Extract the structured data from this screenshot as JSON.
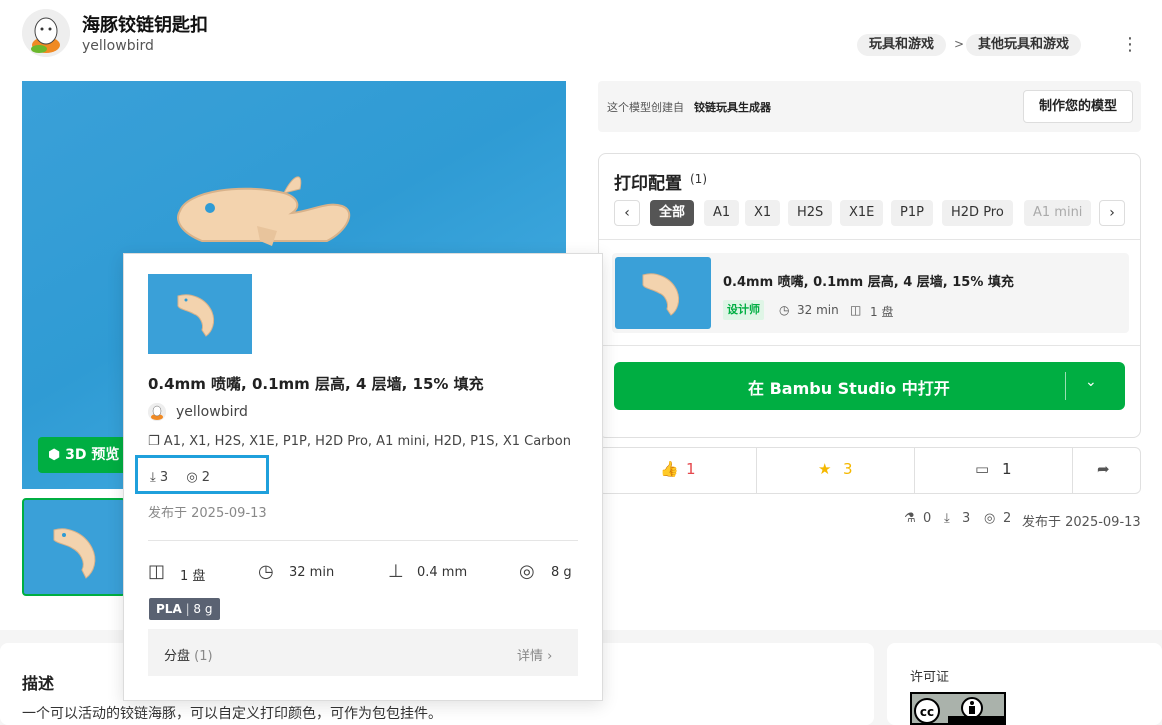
{
  "header": {
    "title": "海豚铰链钥匙扣",
    "author": "yellowbird",
    "breadcrumb": [
      "玩具和游戏",
      "其他玩具和游戏"
    ],
    "breadcrumb_sep": ">",
    "more_icon": "⋮"
  },
  "gallery": {
    "btn_3d_label": "3D 预览"
  },
  "generator": {
    "text": "这个模型创建自",
    "tool": "铰链玩具生成器",
    "make_button": "制作您的模型"
  },
  "print_profile": {
    "title": "打印配置",
    "count": "(1)",
    "prev_arrow": "‹",
    "next_arrow": "›",
    "filters": [
      "全部",
      "A1",
      "X1",
      "H2S",
      "X1E",
      "P1P",
      "H2D Pro",
      "A1 mini"
    ],
    "profile_name": "0.4mm 喷嘴, 0.1mm 层高, 4 层墙, 15% 填充",
    "designer_badge": "设计师",
    "time": "32 min",
    "plates": "1 盘",
    "open_button": "在 Bambu Studio 中打开"
  },
  "actions": {
    "likes": "1",
    "collects": "3",
    "comments": "1"
  },
  "stats": {
    "prints": "0",
    "downloads": "3",
    "makes": "2",
    "published": "发布于 2025-09-13"
  },
  "popup": {
    "title": "0.4mm 喷嘴, 0.1mm 层高, 4 层墙, 15% 填充",
    "author": "yellowbird",
    "printers": "A1, X1, H2S, X1E, P1P, H2D Pro, A1 mini, H2D, P1S, X1 Carbon",
    "downloads": "3",
    "makes": "2",
    "published": "发布于 2025-09-13",
    "plates": "1 盘",
    "time": "32 min",
    "nozzle": "0.4 mm",
    "weight": "8 g",
    "filament_type": "PLA",
    "filament_weight": "8 g",
    "plate_label": "分盘",
    "plate_count": "(1)",
    "details_link": "详情"
  },
  "description": {
    "title": "描述",
    "text": "一个可以活动的铰链海豚，可以自定义打印颜色，可作为包包挂件。"
  },
  "license": {
    "title": "许可证"
  },
  "colors": {
    "brand_green": "#00ae42",
    "highlight_blue": "#1fa0dc",
    "like_red": "#e5484d",
    "collect_yellow": "#f5b800"
  }
}
